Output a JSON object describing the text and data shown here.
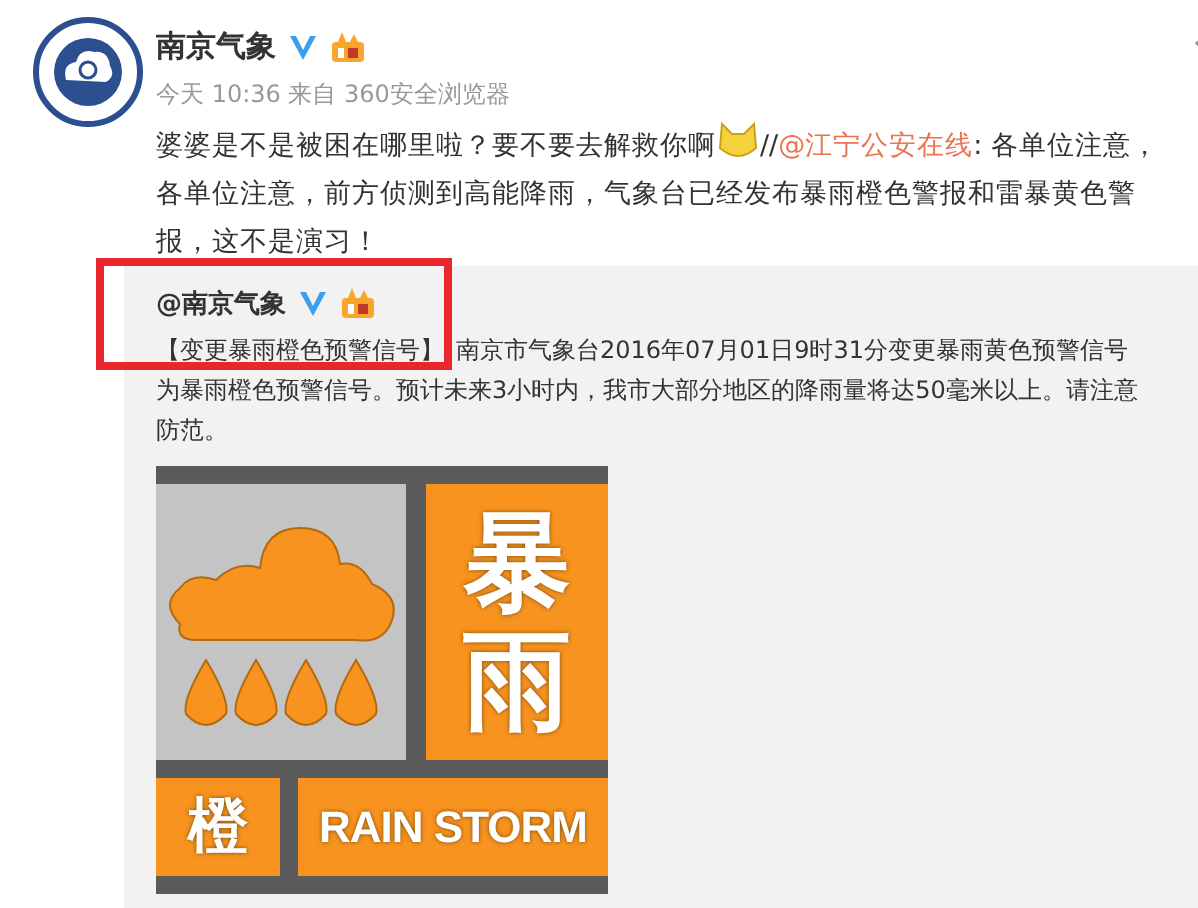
{
  "post": {
    "author": "南京气象",
    "verified": true,
    "meta": "今天 10:36 来自 360安全浏览器",
    "body": [
      {
        "kind": "text",
        "text": "婆婆是不是被困在哪里啦？要不要去解救你啊"
      },
      {
        "kind": "emoji"
      },
      {
        "kind": "text",
        "text": "//"
      },
      {
        "kind": "mention",
        "text": "@江宁公安在线"
      },
      {
        "kind": "text",
        "text": ": 各单位注意，各单位注意，前方侦测到高能降雨，气象台已经发布暴雨橙色警报和雷暴黄色警报，这不是演习！"
      }
    ]
  },
  "repost": {
    "author": "@南京气象",
    "verified": true,
    "highlighted": true,
    "headline": "【变更暴雨橙色预警信号】",
    "text": "南京市气象台2016年07月01日9时31分变更暴雨黄色预警信号为暴雨橙色预警信号。预计未来3小时内，我市大部分地区的降雨量将达50毫米以上。请注意防范。",
    "sign": {
      "title": "暴雨",
      "level": "橙",
      "english": "RAIN STORM",
      "color": "#f7931e"
    }
  }
}
